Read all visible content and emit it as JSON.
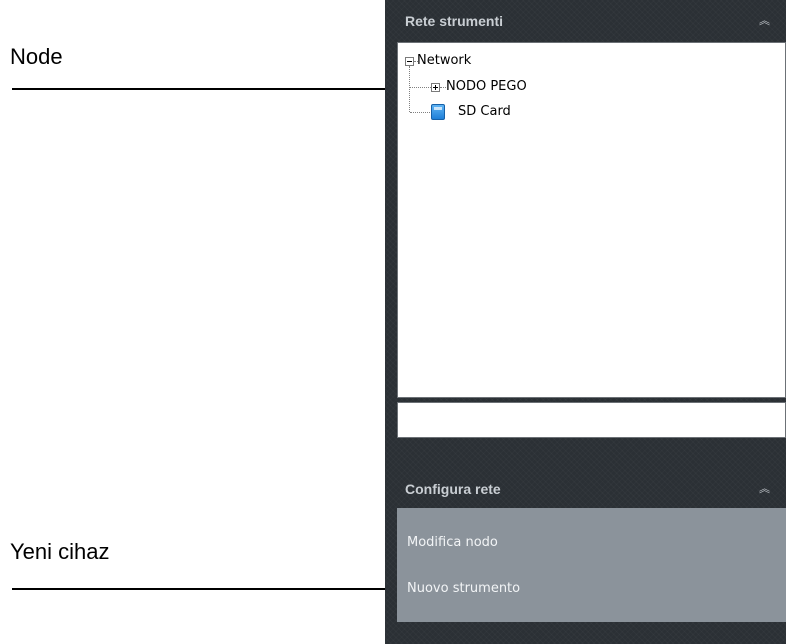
{
  "annotations": {
    "node_label": "Node",
    "new_device_label": "Yeni cihaz"
  },
  "panel": {
    "network_section": {
      "title": "Rete strumenti",
      "collapse_icon": "double-chevron-up-icon"
    },
    "tree": {
      "root": "Network",
      "children": [
        "NODO PEGO",
        "SD Card"
      ]
    },
    "config_section": {
      "title": "Configura rete",
      "collapse_icon": "double-chevron-up-icon",
      "items": [
        "Modifica nodo",
        "Nuovo strumento"
      ]
    }
  },
  "colors": {
    "panel_bg": "#2b3035",
    "header_text": "#c9ced3",
    "menu_bg": "#8b939b",
    "menu_text": "#f2f4f6",
    "sd_icon": "#2a8ae0"
  }
}
